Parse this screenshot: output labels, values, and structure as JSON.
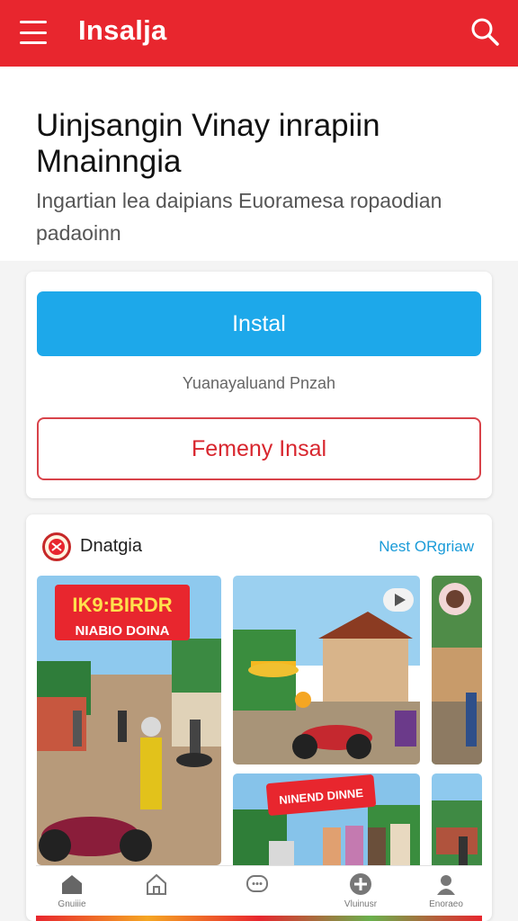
{
  "header": {
    "app_title": "Insalja",
    "menu_icon": "hamburger-menu-icon",
    "search_icon": "search-icon",
    "bar_color": "#e8262e"
  },
  "hero": {
    "title": "Uinjsangin Vinay inrapiin Mnainngia",
    "subtitle": "Ingartian lea daipians Euoramesa ropaodian padaoinn"
  },
  "install_card": {
    "primary_label": "Instal",
    "primary_color": "#1da8ea",
    "caption": "Yuanayaluand Pnzah",
    "secondary_label": "Femeny Insal",
    "secondary_color": "#d8262e"
  },
  "gallery": {
    "title": "Dnatgia",
    "link": "Nest ORgriaw",
    "photos": [
      {
        "name": "street-market-scooters",
        "banner_line1": "IK9:BIRDR",
        "banner_line2": "NIABIO DOINA"
      },
      {
        "name": "village-house-scooter"
      },
      {
        "name": "side-portrait-strip"
      },
      {
        "name": "group-photo-banner",
        "banner_line1": "NINEND DINNE"
      },
      {
        "name": "side-street-strip"
      }
    ],
    "play_icon": "play-icon"
  },
  "bottom_nav": {
    "items": [
      {
        "label": "Gnuiiie",
        "icon": "home-icon"
      },
      {
        "label": "",
        "icon": "house-outline-icon"
      },
      {
        "label": "",
        "icon": "chat-bubble-icon"
      },
      {
        "label": "Vluinusr",
        "icon": "add-circle-icon"
      },
      {
        "label": "Enoraeo",
        "icon": "profile-icon"
      }
    ]
  }
}
